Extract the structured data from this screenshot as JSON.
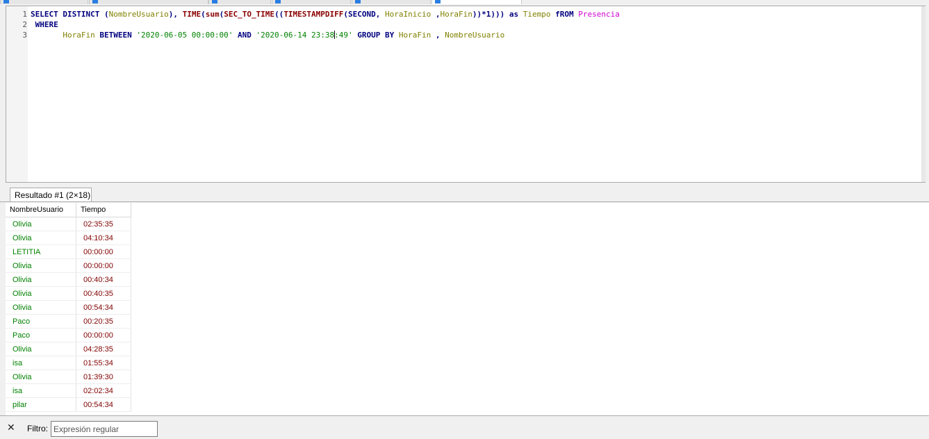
{
  "editor": {
    "line_numbers": [
      "1",
      "2",
      "3"
    ],
    "tokens": {
      "select": "SELECT",
      "distinct": "DISTINCT",
      "nombre_usuario": "NombreUsuario",
      "time_fn": "TIME",
      "sum_fn": "sum",
      "sec_to_time_fn": "SEC_TO_TIME",
      "timestampdiff_fn": "TIMESTAMPDIFF",
      "second_kw": "SECOND",
      "hora_inicio": "HoraInicio",
      "hora_fin": "HoraFin",
      "mult_one": "*1",
      "as_kw": "as",
      "tiempo_alias": "Tiempo",
      "from_kw": "fROM",
      "table": "Presencia",
      "where_kw": "WHERE",
      "between_kw": "BETWEEN",
      "date_start": "'2020-06-05 00:00:00'",
      "and_kw": "AND",
      "date_end_a": "'2020-06-14 23:38",
      "date_end_b": ":49'",
      "group_by_kw": "GROUP BY",
      "comma": ","
    }
  },
  "result_tab": {
    "label": "Resultado #1 (2×18)"
  },
  "grid": {
    "columns": [
      "NombreUsuario",
      "Tiempo"
    ],
    "rows": [
      [
        "Olivia",
        "02:35:35"
      ],
      [
        "Olivia",
        "04:10:34"
      ],
      [
        "LETITIA",
        "00:00:00"
      ],
      [
        "Olivia",
        "00:00:00"
      ],
      [
        "Olivia",
        "00:40:34"
      ],
      [
        "Olivia",
        "00:40:35"
      ],
      [
        "Olivia",
        "00:54:34"
      ],
      [
        "Paco",
        "00:20:35"
      ],
      [
        "Paco",
        "00:00:00"
      ],
      [
        "Olivia",
        "04:28:35"
      ],
      [
        "isa",
        "01:55:34"
      ],
      [
        "Olivia",
        "01:39:30"
      ],
      [
        "isa",
        "02:02:34"
      ],
      [
        "pilar",
        "00:54:34"
      ]
    ]
  },
  "filter": {
    "label": "Filtro:",
    "placeholder": "Expresión regular",
    "value": "",
    "close_symbol": "✕"
  }
}
